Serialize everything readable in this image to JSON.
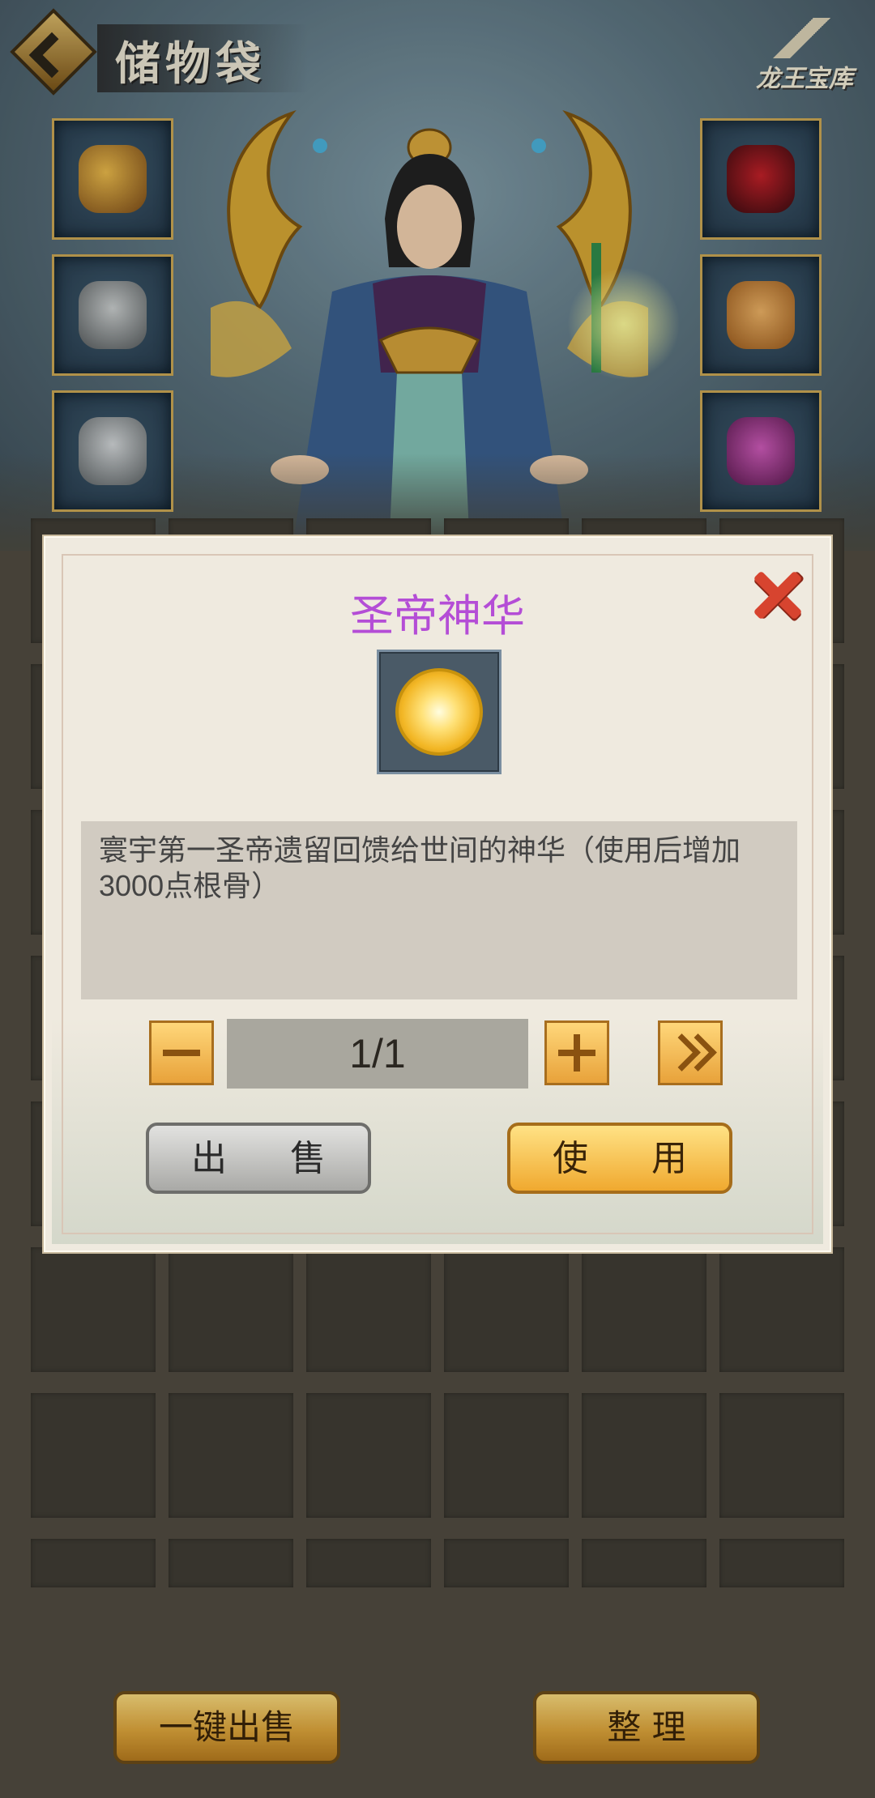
{
  "header": {
    "title": "储物袋",
    "logo_text": "龙王宝库"
  },
  "equipment": {
    "left_slots": [
      "equip-necklace",
      "equip-helmet",
      "equip-armor"
    ],
    "right_slots": [
      "equip-ring",
      "equip-jade-pendant",
      "equip-boots"
    ]
  },
  "dialog": {
    "title": "圣帝神华",
    "description": "寰宇第一圣帝遗留回馈给世间的神华（使用后增加3000点根骨）",
    "quantity": "1/1",
    "sell_label": "出 售",
    "use_label": "使 用",
    "title_color": "#b44dd6"
  },
  "bottom": {
    "sell_all_label": "一键出售",
    "organize_label": "整 理"
  },
  "colors": {
    "gold_accent": "#c9a554",
    "cell_bg": "#3f3c34"
  }
}
